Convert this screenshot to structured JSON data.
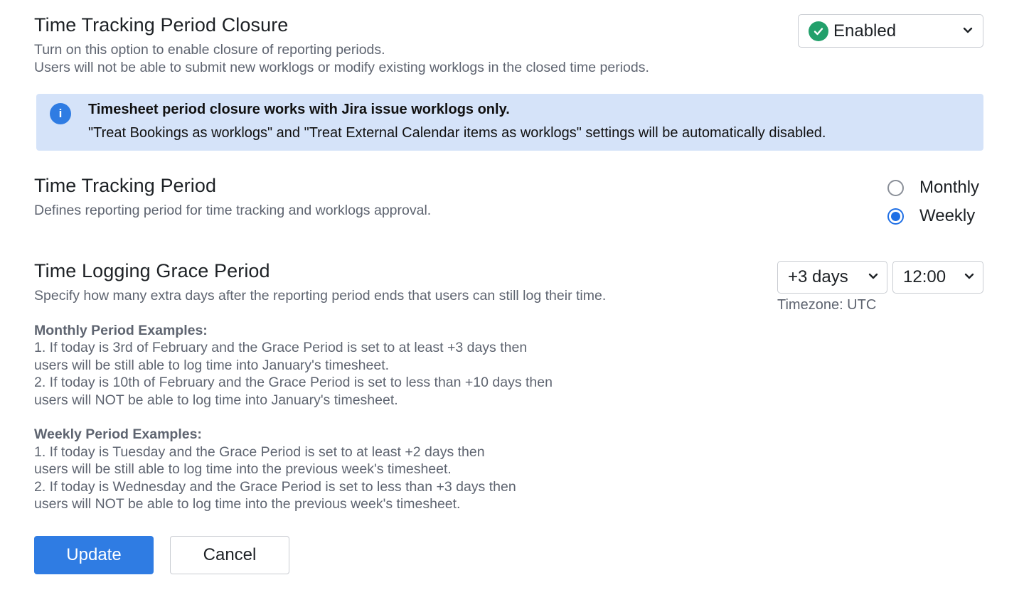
{
  "closure": {
    "title": "Time Tracking Period Closure",
    "desc_line1": "Turn on this option to enable closure of reporting periods.",
    "desc_line2": "Users will not be able to submit new worklogs or modify existing worklogs in the closed time periods.",
    "status_value": "Enabled",
    "status_icon": "check-circle-icon",
    "status_color": "#22a06b"
  },
  "banner": {
    "icon": "info-icon",
    "title": "Timesheet period closure works with Jira issue worklogs only.",
    "body": "\"Treat Bookings as worklogs\" and \"Treat External Calendar items as worklogs\" settings will be automatically disabled.",
    "bg_color": "#d5e3f9"
  },
  "period": {
    "title": "Time Tracking Period",
    "desc": "Defines reporting period for time tracking and worklogs approval.",
    "options": [
      {
        "label": "Monthly",
        "checked": false
      },
      {
        "label": "Weekly",
        "checked": true
      }
    ]
  },
  "grace": {
    "title": "Time Logging Grace Period",
    "desc": "Specify how many extra days after the reporting period ends that users can still log their time.",
    "days_value": "+3 days",
    "time_value": "12:00",
    "timezone": "Timezone: UTC"
  },
  "examples": {
    "monthly_head": "Monthly Period Examples:",
    "monthly_lines": [
      "1. If today is 3rd of February and the Grace Period is set to at least +3 days then",
      "users will be still able to log time into January's timesheet.",
      "2. If today is 10th of February and the Grace Period is set to less than +10 days then",
      "users will NOT be able to log time into January's timesheet."
    ],
    "weekly_head": "Weekly Period Examples:",
    "weekly_lines": [
      "1. If today is Tuesday and the Grace Period is set to at least +2 days then",
      "users will be still able to log time into the previous week's timesheet.",
      "2. If today is Wednesday and the Grace Period is set to less than +3 days then",
      "users will NOT be able to log time into the previous week's timesheet."
    ]
  },
  "actions": {
    "update_label": "Update",
    "cancel_label": "Cancel",
    "primary_color": "#2f7ce3"
  }
}
